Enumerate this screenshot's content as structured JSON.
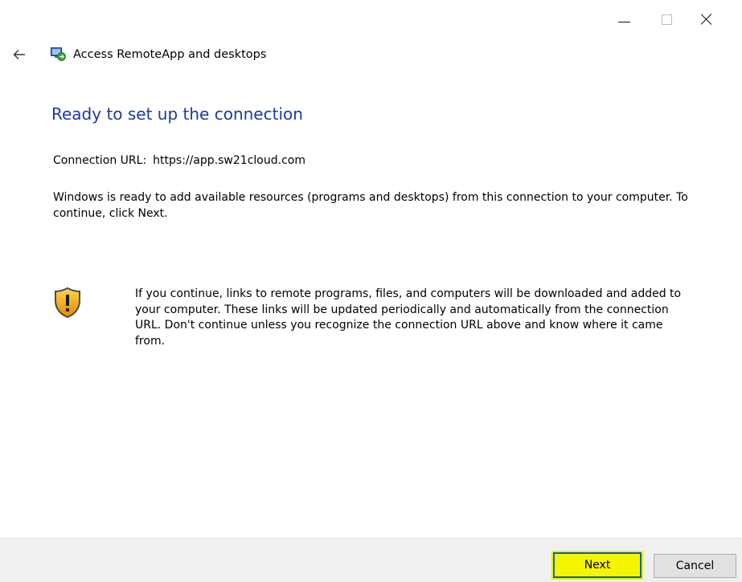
{
  "window": {
    "title": "Access RemoteApp and desktops",
    "controls": {
      "minimize_icon": "minimize-icon",
      "maximize_icon": "maximize-icon",
      "close_icon": "close-icon"
    }
  },
  "header": {
    "back_icon": "back-arrow-icon",
    "app_icon": "remoteapp-icon"
  },
  "content": {
    "heading": "Ready to set up the connection",
    "connection_url_label": "Connection URL:",
    "connection_url_value": "https://app.sw21cloud.com",
    "description": "Windows is ready to add available resources (programs and desktops) from this connection to your computer. To continue, click Next.",
    "warning_icon": "shield-warning-icon",
    "warning_text": "If you continue, links to remote programs, files, and computers will be downloaded and added to your computer.  These links will be updated periodically and automatically from the connection URL. Don't continue unless you recognize the connection URL above and know where it came from."
  },
  "footer": {
    "next_label": "Next",
    "cancel_label": "Cancel"
  },
  "colors": {
    "heading": "#1a3b9c",
    "footer_bg": "#f0f0f0",
    "next_highlight": "#f5f500",
    "next_border": "#0a5fb5"
  }
}
